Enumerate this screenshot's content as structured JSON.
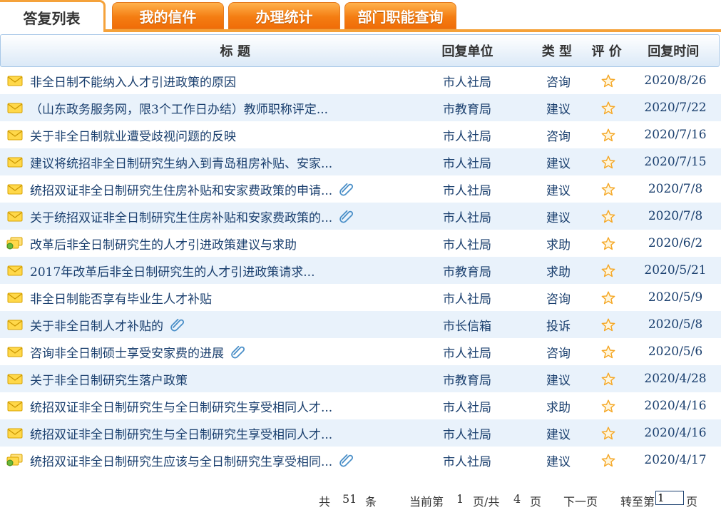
{
  "tabs": [
    {
      "label": "答复列表"
    },
    {
      "label": "我的信件"
    },
    {
      "label": "办理统计"
    },
    {
      "label": "部门职能查询"
    }
  ],
  "headers": {
    "title": "标 题",
    "unit": "回复单位",
    "type": "类 型",
    "rating": "评 价",
    "date": "回复时间"
  },
  "rows": [
    {
      "title": "非全日制不能纳入人才引进政策的原因",
      "unit": "市人社局",
      "type": "咨询",
      "date": "2020/8/26",
      "icon": "envelope-icon",
      "attachment": false
    },
    {
      "title": "（山东政务服务网，限3个工作日办结）教师职称评定...",
      "unit": "市教育局",
      "type": "建议",
      "date": "2020/7/22",
      "icon": "envelope-icon",
      "attachment": false
    },
    {
      "title": "关于非全日制就业遭受歧视问题的反映",
      "unit": "市人社局",
      "type": "咨询",
      "date": "2020/7/16",
      "icon": "envelope-icon",
      "attachment": false
    },
    {
      "title": "建议将统招非全日制研究生纳入到青岛租房补贴、安家...",
      "unit": "市人社局",
      "type": "建议",
      "date": "2020/7/15",
      "icon": "envelope-icon",
      "attachment": false
    },
    {
      "title": "统招双证非全日制研究生住房补贴和安家费政策的申请...",
      "unit": "市人社局",
      "type": "建议",
      "date": "2020/7/8",
      "icon": "envelope-icon",
      "attachment": true
    },
    {
      "title": "关于统招双证非全日制研究生住房补贴和安家费政策的...",
      "unit": "市人社局",
      "type": "建议",
      "date": "2020/7/8",
      "icon": "envelope-icon",
      "attachment": true
    },
    {
      "title": "改革后非全日制研究生的人才引进政策建议与求助",
      "unit": "市人社局",
      "type": "求助",
      "date": "2020/6/2",
      "icon": "envelope-group-icon",
      "attachment": false
    },
    {
      "title": "2017年改革后非全日制研究生的人才引进政策请求...",
      "unit": "市教育局",
      "type": "求助",
      "date": "2020/5/21",
      "icon": "envelope-icon",
      "attachment": false
    },
    {
      "title": "非全日制能否享有毕业生人才补贴",
      "unit": "市人社局",
      "type": "咨询",
      "date": "2020/5/9",
      "icon": "envelope-icon",
      "attachment": false
    },
    {
      "title": "关于非全日制人才补贴的",
      "unit": "市长信箱",
      "type": "投诉",
      "date": "2020/5/8",
      "icon": "envelope-icon",
      "attachment": true
    },
    {
      "title": "咨询非全日制硕士享受安家费的进展",
      "unit": "市人社局",
      "type": "咨询",
      "date": "2020/5/6",
      "icon": "envelope-icon",
      "attachment": true
    },
    {
      "title": "关于非全日制研究生落户政策",
      "unit": "市教育局",
      "type": "建议",
      "date": "2020/4/28",
      "icon": "envelope-icon",
      "attachment": false
    },
    {
      "title": "统招双证非全日制研究生与全日制研究生享受相同人才...",
      "unit": "市人社局",
      "type": "求助",
      "date": "2020/4/16",
      "icon": "envelope-icon",
      "attachment": false
    },
    {
      "title": "统招双证非全日制研究生与全日制研究生享受相同人才...",
      "unit": "市人社局",
      "type": "建议",
      "date": "2020/4/16",
      "icon": "envelope-icon",
      "attachment": false
    },
    {
      "title": "统招双证非全日制研究生应该与全日制研究生享受相同...",
      "unit": "市人社局",
      "type": "建议",
      "date": "2020/4/17",
      "icon": "envelope-group-icon",
      "attachment": true
    }
  ],
  "pager": {
    "total_prefix": "共",
    "total": "51",
    "total_suffix": "条",
    "current_prefix": "当前第",
    "current": "1",
    "pages_mid": "页/共",
    "pages": "4",
    "pages_suffix": "页",
    "next": "下一页",
    "goto_prefix": "转至第",
    "goto_value": "1",
    "goto_suffix": "页"
  },
  "colors": {
    "tab_orange": "#f47d12",
    "text_blue": "#1a3f6e",
    "row_alt": "#e9f2fb",
    "star": "#f5a623"
  }
}
